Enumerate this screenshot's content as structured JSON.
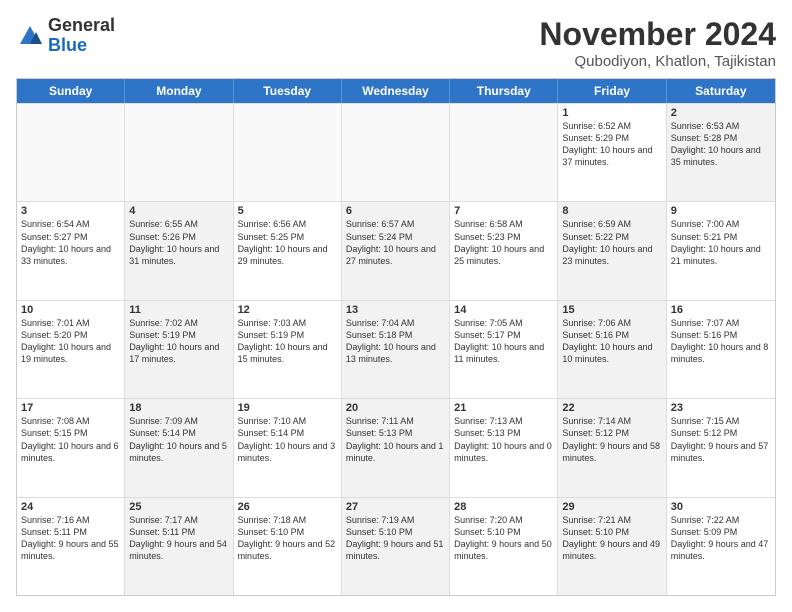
{
  "logo": {
    "general": "General",
    "blue": "Blue"
  },
  "title": "November 2024",
  "location": "Qubodiyon, Khatlon, Tajikistan",
  "header_days": [
    "Sunday",
    "Monday",
    "Tuesday",
    "Wednesday",
    "Thursday",
    "Friday",
    "Saturday"
  ],
  "weeks": [
    [
      {
        "day": "",
        "text": "",
        "shaded": false,
        "empty": true
      },
      {
        "day": "",
        "text": "",
        "shaded": false,
        "empty": true
      },
      {
        "day": "",
        "text": "",
        "shaded": false,
        "empty": true
      },
      {
        "day": "",
        "text": "",
        "shaded": false,
        "empty": true
      },
      {
        "day": "",
        "text": "",
        "shaded": false,
        "empty": true
      },
      {
        "day": "1",
        "text": "Sunrise: 6:52 AM\nSunset: 5:29 PM\nDaylight: 10 hours and 37 minutes.",
        "shaded": false,
        "empty": false
      },
      {
        "day": "2",
        "text": "Sunrise: 6:53 AM\nSunset: 5:28 PM\nDaylight: 10 hours and 35 minutes.",
        "shaded": true,
        "empty": false
      }
    ],
    [
      {
        "day": "3",
        "text": "Sunrise: 6:54 AM\nSunset: 5:27 PM\nDaylight: 10 hours and 33 minutes.",
        "shaded": false,
        "empty": false
      },
      {
        "day": "4",
        "text": "Sunrise: 6:55 AM\nSunset: 5:26 PM\nDaylight: 10 hours and 31 minutes.",
        "shaded": true,
        "empty": false
      },
      {
        "day": "5",
        "text": "Sunrise: 6:56 AM\nSunset: 5:25 PM\nDaylight: 10 hours and 29 minutes.",
        "shaded": false,
        "empty": false
      },
      {
        "day": "6",
        "text": "Sunrise: 6:57 AM\nSunset: 5:24 PM\nDaylight: 10 hours and 27 minutes.",
        "shaded": true,
        "empty": false
      },
      {
        "day": "7",
        "text": "Sunrise: 6:58 AM\nSunset: 5:23 PM\nDaylight: 10 hours and 25 minutes.",
        "shaded": false,
        "empty": false
      },
      {
        "day": "8",
        "text": "Sunrise: 6:59 AM\nSunset: 5:22 PM\nDaylight: 10 hours and 23 minutes.",
        "shaded": true,
        "empty": false
      },
      {
        "day": "9",
        "text": "Sunrise: 7:00 AM\nSunset: 5:21 PM\nDaylight: 10 hours and 21 minutes.",
        "shaded": false,
        "empty": false
      }
    ],
    [
      {
        "day": "10",
        "text": "Sunrise: 7:01 AM\nSunset: 5:20 PM\nDaylight: 10 hours and 19 minutes.",
        "shaded": false,
        "empty": false
      },
      {
        "day": "11",
        "text": "Sunrise: 7:02 AM\nSunset: 5:19 PM\nDaylight: 10 hours and 17 minutes.",
        "shaded": true,
        "empty": false
      },
      {
        "day": "12",
        "text": "Sunrise: 7:03 AM\nSunset: 5:19 PM\nDaylight: 10 hours and 15 minutes.",
        "shaded": false,
        "empty": false
      },
      {
        "day": "13",
        "text": "Sunrise: 7:04 AM\nSunset: 5:18 PM\nDaylight: 10 hours and 13 minutes.",
        "shaded": true,
        "empty": false
      },
      {
        "day": "14",
        "text": "Sunrise: 7:05 AM\nSunset: 5:17 PM\nDaylight: 10 hours and 11 minutes.",
        "shaded": false,
        "empty": false
      },
      {
        "day": "15",
        "text": "Sunrise: 7:06 AM\nSunset: 5:16 PM\nDaylight: 10 hours and 10 minutes.",
        "shaded": true,
        "empty": false
      },
      {
        "day": "16",
        "text": "Sunrise: 7:07 AM\nSunset: 5:16 PM\nDaylight: 10 hours and 8 minutes.",
        "shaded": false,
        "empty": false
      }
    ],
    [
      {
        "day": "17",
        "text": "Sunrise: 7:08 AM\nSunset: 5:15 PM\nDaylight: 10 hours and 6 minutes.",
        "shaded": false,
        "empty": false
      },
      {
        "day": "18",
        "text": "Sunrise: 7:09 AM\nSunset: 5:14 PM\nDaylight: 10 hours and 5 minutes.",
        "shaded": true,
        "empty": false
      },
      {
        "day": "19",
        "text": "Sunrise: 7:10 AM\nSunset: 5:14 PM\nDaylight: 10 hours and 3 minutes.",
        "shaded": false,
        "empty": false
      },
      {
        "day": "20",
        "text": "Sunrise: 7:11 AM\nSunset: 5:13 PM\nDaylight: 10 hours and 1 minute.",
        "shaded": true,
        "empty": false
      },
      {
        "day": "21",
        "text": "Sunrise: 7:13 AM\nSunset: 5:13 PM\nDaylight: 10 hours and 0 minutes.",
        "shaded": false,
        "empty": false
      },
      {
        "day": "22",
        "text": "Sunrise: 7:14 AM\nSunset: 5:12 PM\nDaylight: 9 hours and 58 minutes.",
        "shaded": true,
        "empty": false
      },
      {
        "day": "23",
        "text": "Sunrise: 7:15 AM\nSunset: 5:12 PM\nDaylight: 9 hours and 57 minutes.",
        "shaded": false,
        "empty": false
      }
    ],
    [
      {
        "day": "24",
        "text": "Sunrise: 7:16 AM\nSunset: 5:11 PM\nDaylight: 9 hours and 55 minutes.",
        "shaded": false,
        "empty": false
      },
      {
        "day": "25",
        "text": "Sunrise: 7:17 AM\nSunset: 5:11 PM\nDaylight: 9 hours and 54 minutes.",
        "shaded": true,
        "empty": false
      },
      {
        "day": "26",
        "text": "Sunrise: 7:18 AM\nSunset: 5:10 PM\nDaylight: 9 hours and 52 minutes.",
        "shaded": false,
        "empty": false
      },
      {
        "day": "27",
        "text": "Sunrise: 7:19 AM\nSunset: 5:10 PM\nDaylight: 9 hours and 51 minutes.",
        "shaded": true,
        "empty": false
      },
      {
        "day": "28",
        "text": "Sunrise: 7:20 AM\nSunset: 5:10 PM\nDaylight: 9 hours and 50 minutes.",
        "shaded": false,
        "empty": false
      },
      {
        "day": "29",
        "text": "Sunrise: 7:21 AM\nSunset: 5:10 PM\nDaylight: 9 hours and 49 minutes.",
        "shaded": true,
        "empty": false
      },
      {
        "day": "30",
        "text": "Sunrise: 7:22 AM\nSunset: 5:09 PM\nDaylight: 9 hours and 47 minutes.",
        "shaded": false,
        "empty": false
      }
    ]
  ]
}
